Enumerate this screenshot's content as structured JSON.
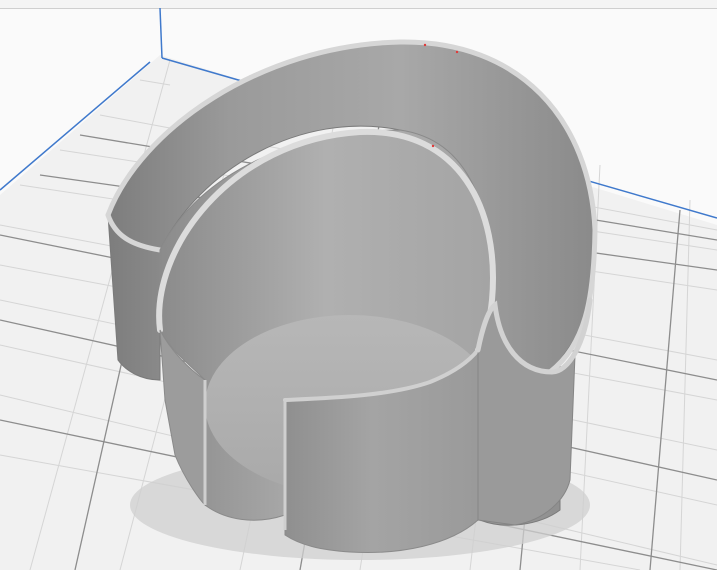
{
  "app": {
    "view": "3d-print-preview"
  },
  "colors": {
    "background": "#fafafa",
    "plate": "#f1f1f1",
    "grid_major": "#8d8d8d",
    "grid_minor": "#d5d5d5",
    "plate_border": "#3f79cc",
    "model": "#a8a8a8",
    "model_highlight": "#d6d6d6"
  },
  "model": {
    "type": "cup-holder",
    "visible_shape": "concentric-open-curved-walls"
  }
}
